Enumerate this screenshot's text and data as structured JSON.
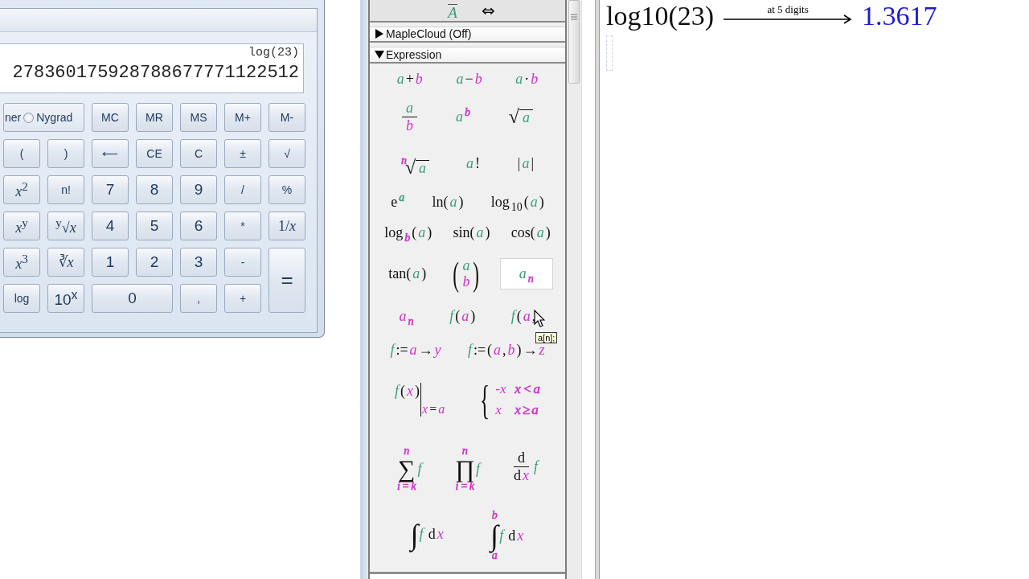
{
  "calculator": {
    "expression": "log(23)",
    "value": "278360175928788677771122512",
    "angle_mode": {
      "cut_label": "ner",
      "option": {
        "label": "Nygrad",
        "selected": false
      }
    },
    "buttons": [
      {
        "label": "MC",
        "kind": "key"
      },
      {
        "label": "MR",
        "kind": "key"
      },
      {
        "label": "MS",
        "kind": "key"
      },
      {
        "label": "M+",
        "kind": "key"
      },
      {
        "label": "M-",
        "kind": "key"
      },
      {
        "label": "(",
        "kind": "key"
      },
      {
        "label": ")",
        "kind": "key"
      },
      {
        "label": "⟵",
        "kind": "key"
      },
      {
        "label": "CE",
        "kind": "key"
      },
      {
        "label": "C",
        "kind": "key"
      },
      {
        "label": "±",
        "kind": "key"
      },
      {
        "label": "√",
        "kind": "key"
      },
      {
        "label": "*x*$^{2}$",
        "kind": "math"
      },
      {
        "label": "n!",
        "kind": "key"
      },
      {
        "label": "7",
        "kind": "digit"
      },
      {
        "label": "8",
        "kind": "digit"
      },
      {
        "label": "9",
        "kind": "digit"
      },
      {
        "label": "/",
        "kind": "key"
      },
      {
        "label": "%",
        "kind": "key"
      },
      {
        "label": "*x*$^{y}$",
        "kind": "math"
      },
      {
        "label": "$^{y}$√*x*",
        "kind": "math"
      },
      {
        "label": "4",
        "kind": "digit"
      },
      {
        "label": "5",
        "kind": "digit"
      },
      {
        "label": "6",
        "kind": "digit"
      },
      {
        "label": "*",
        "kind": "key"
      },
      {
        "label": "1/*x*",
        "kind": "math"
      },
      {
        "label": "*x*$^{3}$",
        "kind": "math"
      },
      {
        "label": "∛*x*",
        "kind": "math"
      },
      {
        "label": "1",
        "kind": "digit"
      },
      {
        "label": "2",
        "kind": "digit"
      },
      {
        "label": "3",
        "kind": "digit"
      },
      {
        "label": "-",
        "kind": "key"
      },
      {
        "label": "=",
        "kind": "tall"
      },
      {
        "label": "log",
        "kind": "key"
      },
      {
        "label": "10$^{x}$",
        "kind": "digit"
      },
      {
        "label": "0",
        "kind": "wide"
      },
      {
        "label": ",",
        "kind": "key"
      },
      {
        "label": "+",
        "kind": "key"
      }
    ]
  },
  "palette": {
    "top_section": {
      "symbol": "A",
      "arrow": "⇔"
    },
    "sections": [
      {
        "title": "MapleCloud (Off)",
        "expanded": false
      },
      {
        "title": "Expression",
        "expanded": true,
        "rows": [
          {
            "items": [
              {
                "kind": "inline",
                "highlighted": false,
                "parts": [
                  {
                    "text": "a",
                    "color": "#3a9e7c"
                  },
                  {
                    "text": "+"
                  },
                  {
                    "text": "b",
                    "color": "#cc33cc"
                  }
                ]
              },
              {
                "kind": "inline",
                "highlighted": false,
                "parts": [
                  {
                    "text": "a",
                    "color": "#3a9e7c"
                  },
                  {
                    "text": "−"
                  },
                  {
                    "text": "b",
                    "color": "#cc33cc"
                  }
                ]
              },
              {
                "kind": "inline",
                "highlighted": false,
                "parts": [
                  {
                    "text": "a",
                    "color": "#3a9e7c"
                  },
                  {
                    "text": "·"
                  },
                  {
                    "text": "b",
                    "color": "#cc33cc"
                  }
                ]
              }
            ]
          },
          {
            "items": [
              {
                "kind": "frac",
                "highlighted": false,
                "top": [
                  {
                    "text": "a",
                    "color": "#3a9e7c"
                  }
                ],
                "bottom": [
                  {
                    "text": "b",
                    "color": "#cc33cc"
                  }
                ]
              },
              {
                "kind": "inline",
                "highlighted": false,
                "parts": [
                  {
                    "text": "a",
                    "color": "#3a9e7c",
                    "sup": [
                      {
                        "text": "b",
                        "color": "#cc33cc"
                      }
                    ]
                  }
                ]
              },
              {
                "kind": "root",
                "highlighted": false,
                "sign": "√",
                "body": [
                  {
                    "text": "a",
                    "color": "#3a9e7c"
                  }
                ]
              }
            ]
          },
          {
            "items": [
              {
                "kind": "root",
                "highlighted": false,
                "index": [
                  {
                    "text": "n",
                    "color": "#cc33cc"
                  }
                ],
                "sign": "√",
                "body": [
                  {
                    "text": "a",
                    "color": "#3a9e7c"
                  }
                ]
              },
              {
                "kind": "inline",
                "highlighted": false,
                "parts": [
                  {
                    "text": "a",
                    "color": "#3a9e7c"
                  },
                  {
                    "text": "!"
                  }
                ]
              },
              {
                "kind": "inline",
                "highlighted": false,
                "parts": [
                  {
                    "text": "|"
                  },
                  {
                    "text": "a",
                    "color": "#3a9e7c"
                  },
                  {
                    "text": "|"
                  }
                ]
              }
            ]
          },
          {
            "items": [
              {
                "kind": "inline",
                "highlighted": false,
                "parts": [
                  {
                    "text": "e",
                    "sup": [
                      {
                        "text": "a",
                        "color": "#3a9e7c"
                      }
                    ]
                  }
                ]
              },
              {
                "kind": "inline",
                "highlighted": false,
                "parts": [
                  {
                    "text": "ln("
                  },
                  {
                    "text": "a",
                    "color": "#3a9e7c"
                  },
                  {
                    "text": ")"
                  }
                ]
              },
              {
                "kind": "inline",
                "highlighted": false,
                "parts": [
                  {
                    "text": "log",
                    "sub": [
                      {
                        "text": "10"
                      }
                    ]
                  },
                  {
                    "text": "("
                  },
                  {
                    "text": "a",
                    "color": "#3a9e7c"
                  },
                  {
                    "text": ")"
                  }
                ]
              }
            ]
          },
          {
            "items": [
              {
                "kind": "inline",
                "highlighted": false,
                "parts": [
                  {
                    "text": "log",
                    "sub": [
                      {
                        "text": "b",
                        "color": "#cc33cc"
                      }
                    ]
                  },
                  {
                    "text": "("
                  },
                  {
                    "text": "a",
                    "color": "#3a9e7c"
                  },
                  {
                    "text": ")"
                  }
                ]
              },
              {
                "kind": "inline",
                "highlighted": false,
                "parts": [
                  {
                    "text": "sin("
                  },
                  {
                    "text": "a",
                    "color": "#3a9e7c"
                  },
                  {
                    "text": ")"
                  }
                ]
              },
              {
                "kind": "inline",
                "highlighted": false,
                "parts": [
                  {
                    "text": "cos("
                  },
                  {
                    "text": "a",
                    "color": "#3a9e7c"
                  },
                  {
                    "text": ")"
                  }
                ]
              }
            ]
          },
          {
            "items": [
              {
                "kind": "inline",
                "highlighted": false,
                "parts": [
                  {
                    "text": "tan("
                  },
                  {
                    "text": "a",
                    "color": "#3a9e7c"
                  },
                  {
                    "text": ")"
                  }
                ]
              },
              {
                "kind": "vector",
                "highlighted": false,
                "open": "(",
                "close": ")",
                "rows": [
                  [
                    {
                      "text": "a",
                      "color": "#3a9e7c"
                    }
                  ],
                  [
                    {
                      "text": "b",
                      "color": "#cc33cc"
                    }
                  ]
                ]
              },
              {
                "kind": "inline",
                "highlighted": true,
                "parts": [
                  {
                    "text": "a",
                    "color": "#3a9e7c",
                    "sub": [
                      {
                        "text": "n",
                        "color": "#cc33cc"
                      }
                    ]
                  }
                ]
              }
            ]
          },
          {
            "items": [
              {
                "kind": "inline",
                "highlighted": false,
                "parts": [
                  {
                    "text": "a",
                    "color": "#cc33cc",
                    "sub": [
                      {
                        "text": "n",
                        "color": "#cc33cc"
                      }
                    ]
                  }
                ]
              },
              {
                "kind": "inline",
                "highlighted": false,
                "parts": [
                  {
                    "text": "f",
                    "color": "#3a9e7c"
                  },
                  {
                    "text": "("
                  },
                  {
                    "text": "a",
                    "color": "#cc33cc"
                  },
                  {
                    "text": ")"
                  }
                ]
              },
              {
                "kind": "inline",
                "highlighted": false,
                "parts": [
                  {
                    "text": "f",
                    "color": "#3a9e7c"
                  },
                  {
                    "text": "("
                  },
                  {
                    "text": "a",
                    "color": "#cc33cc"
                  },
                  {
                    "text": ","
                  }
                ]
              }
            ]
          },
          {
            "items": [
              {
                "kind": "inline",
                "highlighted": false,
                "parts": [
                  {
                    "text": "f",
                    "color": "#3a9e7c"
                  },
                  {
                    "text": ":="
                  },
                  {
                    "text": "a",
                    "color": "#cc33cc"
                  },
                  {
                    "text": "→"
                  },
                  {
                    "text": "y",
                    "color": "#cc33cc"
                  }
                ]
              },
              {
                "kind": "inline",
                "highlighted": false,
                "parts": [
                  {
                    "text": "f",
                    "color": "#3a9e7c"
                  },
                  {
                    "text": ":="
                  },
                  {
                    "text": "("
                  },
                  {
                    "text": "a",
                    "color": "#cc33cc"
                  },
                  {
                    "text": ","
                  },
                  {
                    "text": "b",
                    "color": "#cc33cc"
                  },
                  {
                    "text": ")"
                  },
                  {
                    "text": "→"
                  },
                  {
                    "text": "z",
                    "color": "#cc33cc"
                  }
                ]
              }
            ]
          },
          {
            "items": [
              {
                "kind": "eval",
                "highlighted": false,
                "body": [
                  {
                    "text": "f",
                    "color": "#3a9e7c"
                  },
                  {
                    "text": "("
                  },
                  {
                    "text": "x",
                    "color": "#cc33cc"
                  },
                  {
                    "text": ")"
                  }
                ],
                "at": [
                  {
                    "text": "x",
                    "color": "#cc33cc"
                  },
                  {
                    "text": "="
                  },
                  {
                    "text": "a",
                    "color": "#cc33cc"
                  }
                ]
              },
              {
                "kind": "piecewise",
                "highlighted": false,
                "brace": "{",
                "cases": [
                  {
                    "value": [
                      {
                        "text": "-x",
                        "color": "#cc33cc"
                      }
                    ],
                    "condition": [
                      {
                        "text": "x",
                        "color": "#cc33cc"
                      },
                      {
                        "text": "<",
                        "color": "#cc33cc"
                      },
                      {
                        "text": "a",
                        "color": "#cc33cc"
                      }
                    ]
                  },
                  {
                    "value": [
                      {
                        "text": "x",
                        "color": "#cc33cc"
                      }
                    ],
                    "condition": [
                      {
                        "text": "x",
                        "color": "#cc33cc"
                      },
                      {
                        "text": "≥",
                        "color": "#cc33cc"
                      },
                      {
                        "text": "a",
                        "color": "#cc33cc"
                      }
                    ]
                  }
                ]
              }
            ]
          },
          {
            "items": [
              {
                "kind": "bigop",
                "highlighted": false,
                "sign": "∑",
                "upper": [
                  {
                    "text": "n",
                    "color": "#cc33cc"
                  }
                ],
                "lower": [
                  {
                    "text": "i",
                    "color": "#cc33cc"
                  },
                  {
                    "text": "=",
                    "color": "#cc33cc"
                  },
                  {
                    "text": "k",
                    "color": "#cc33cc"
                  }
                ],
                "body": [
                  {
                    "text": "f",
                    "color": "#3a9e7c"
                  }
                ]
              },
              {
                "kind": "bigop",
                "highlighted": false,
                "sign": "∏",
                "upper": [
                  {
                    "text": "n",
                    "color": "#cc33cc"
                  }
                ],
                "lower": [
                  {
                    "text": "i",
                    "color": "#cc33cc"
                  },
                  {
                    "text": "=",
                    "color": "#cc33cc"
                  },
                  {
                    "text": "k",
                    "color": "#cc33cc"
                  }
                ],
                "body": [
                  {
                    "text": "f",
                    "color": "#3a9e7c"
                  }
                ]
              },
              {
                "kind": "frac",
                "highlighted": false,
                "top": [
                  {
                    "text": "d"
                  }
                ],
                "bottom": [
                  {
                    "text": "d"
                  },
                  {
                    "text": "x",
                    "color": "#cc33cc"
                  }
                ],
                "after": [
                  {
                    "text": "f",
                    "color": "#3a9e7c"
                  }
                ]
              }
            ]
          },
          {
            "items": [
              {
                "kind": "integral",
                "highlighted": false,
                "sign": "∫",
                "body": [
                  {
                    "text": "f",
                    "color": "#3a9e7c"
                  },
                  {
                    "text": "d"
                  },
                  {
                    "text": "x",
                    "color": "#cc33cc"
                  }
                ]
              },
              {
                "kind": "integral",
                "highlighted": false,
                "sign": "∫",
                "upper": [
                  {
                    "text": "b",
                    "color": "#cc33cc"
                  }
                ],
                "lower": [
                  {
                    "text": "a",
                    "color": "#cc33cc"
                  }
                ],
                "body": [
                  {
                    "text": "f",
                    "color": "#3a9e7c"
                  },
                  {
                    "text": "d"
                  },
                  {
                    "text": "x",
                    "color": "#cc33cc"
                  }
                ]
              }
            ]
          }
        ]
      }
    ],
    "tooltip": "a[n];"
  },
  "document": {
    "input": "log10(23)",
    "arrow_label": "at 5 digits",
    "result": "1.3617"
  }
}
